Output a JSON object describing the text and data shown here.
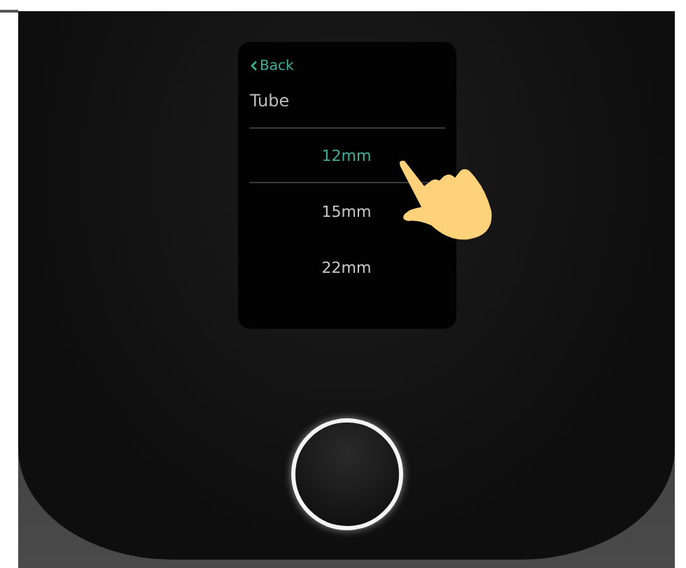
{
  "screen": {
    "back": "Back",
    "title": "Tube",
    "options": [
      {
        "label": "12mm",
        "selected": true
      },
      {
        "label": "15mm",
        "selected": false
      },
      {
        "label": "22mm",
        "selected": false
      }
    ]
  }
}
